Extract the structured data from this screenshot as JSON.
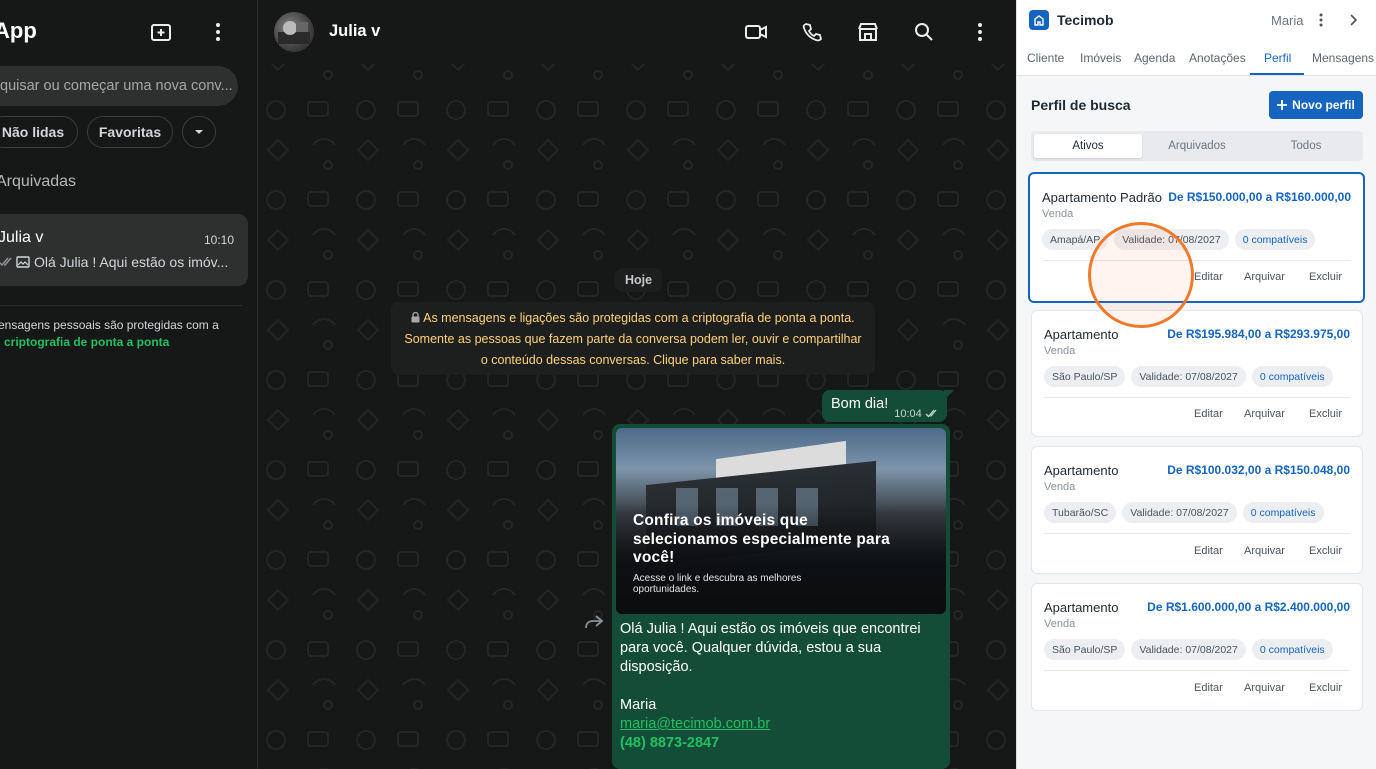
{
  "left": {
    "app_title": "App",
    "search_placeholder": "quisar ou começar uma nova conv...",
    "chips": [
      "Não lidas",
      "Favoritas"
    ],
    "archived": "Arquivadas",
    "chat": {
      "name": "Julia v",
      "time": "10:10",
      "preview": "Olá Julia ! Aqui estão os imóv..."
    },
    "enc_note": "ensagens pessoais são protegidas com a",
    "enc_link": "criptografia de ponta a ponta"
  },
  "chat": {
    "contact_name": "Julia v",
    "date_pill": "Hoje",
    "encryption_notice": "Às mensagens e ligações são protegidas com a criptografia de ponta a ponta. Somente as pessoas que fazem parte da conversa podem ler, ouvir e compartilhar o conteúdo dessas conversas. Clique para saber mais.",
    "enc_line1": "As mensagens e ligações são protegidas com a criptografia de ponta a ponta.",
    "enc_line2": "Somente as pessoas que fazem parte da conversa podem ler, ouvir e compartilhar",
    "enc_line3": "o conteúdo dessas conversas. Clique para saber mais.",
    "message1": {
      "text": "Bom dia!",
      "time": "10:04"
    },
    "card": {
      "headline": "Confira os imóveis que selecionamos especialmente para você!",
      "subline": "Acesse o link e descubra as melhores oportunidades.",
      "body_line1": "Olá Julia ! Aqui estão os imóveis que encontrei",
      "body_line2": "para você. Qualquer dúvida, estou a sua",
      "body_line3": "disposição.",
      "signature": "Maria",
      "email": "maria@tecimob.com.br",
      "phone": "(48) 8873-2847"
    }
  },
  "right": {
    "brand": "Tecimob",
    "user": "Maria",
    "tabs": [
      "Cliente",
      "Imóveis",
      "Agenda",
      "Anotações",
      "Perfil",
      "Mensagens"
    ],
    "active_tab": "Perfil",
    "section_title": "Perfil de busca",
    "new_button": "Novo perfil",
    "segments": [
      "Ativos",
      "Arquivados",
      "Todos"
    ],
    "actions": [
      "Editar",
      "Arquivar",
      "Excluir"
    ],
    "profiles": [
      {
        "title": "Apartamento Padrão",
        "price": "De R$150.000,00 a R$160.000,00",
        "type": "Venda",
        "location": "Amapá/AP",
        "validity": "Validade: 07/08/2027",
        "matches": "0 compatíveis"
      },
      {
        "title": "Apartamento",
        "price": "De R$195.984,00 a R$293.975,00",
        "type": "Venda",
        "location": "São Paulo/SP",
        "validity": "Validade: 07/08/2027",
        "matches": "0 compatíveis"
      },
      {
        "title": "Apartamento",
        "price": "De R$100.032,00 a R$150.048,00",
        "type": "Venda",
        "location": "Tubarão/SC",
        "validity": "Validade: 07/08/2027",
        "matches": "0 compatíveis"
      },
      {
        "title": "Apartamento",
        "price": "De R$1.600.000,00 a R$2.400.000,00",
        "type": "Venda",
        "location": "São Paulo/SP",
        "validity": "Validade: 07/08/2027",
        "matches": "0 compatíveis"
      }
    ]
  },
  "colors": {
    "accent_green": "#21c063",
    "bubble_out": "#144d37",
    "brand_blue": "#1565c0",
    "highlight_orange": "#f07a2a"
  }
}
